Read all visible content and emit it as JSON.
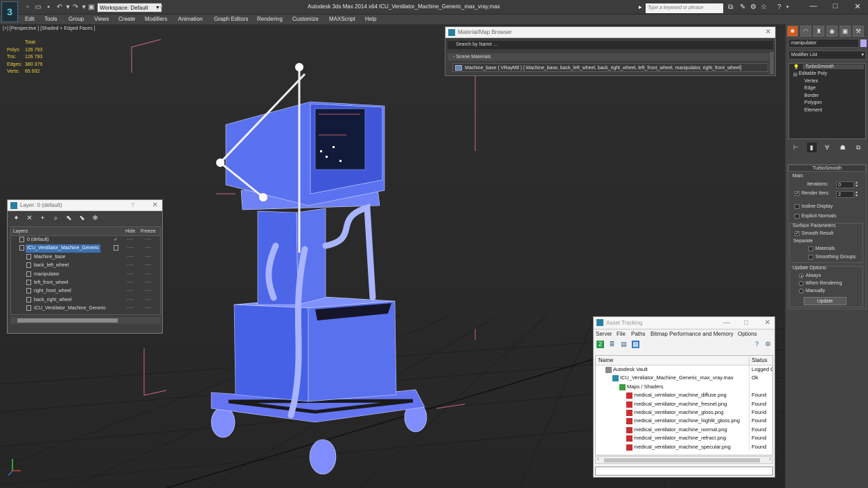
{
  "titlebar": {
    "app_logo": "3",
    "workspace_label": "Workspace: Default",
    "title": "Autodesk 3ds Max  2014 x64      ICU_Ventilator_Machine_Generic_max_vray.max",
    "search_placeholder": "Type a keyword or phrase",
    "minimize": "—",
    "maximize": "□",
    "close": "✕"
  },
  "menu": [
    "Edit",
    "Tools",
    "Group",
    "Views",
    "Create",
    "Modifiers",
    "Animation",
    "Graph Editors",
    "Rendering",
    "Customize",
    "MAXScript",
    "Help"
  ],
  "viewport": {
    "label": "[+] [Perspective ] [Shaded + Edged Faces ]",
    "stats_header": "Total",
    "stats": [
      {
        "k": "Polys:",
        "v": "126 793"
      },
      {
        "k": "Tris:",
        "v": "126 793"
      },
      {
        "k": "Edges:",
        "v": "380 379"
      },
      {
        "k": "Verts:",
        "v": "65 932"
      }
    ]
  },
  "material_browser": {
    "title": "Material/Map Browser",
    "search": "Search by Name ...",
    "section": "- Scene Materials",
    "item": "Machine_base  ( VRayMtl )  [ Machine_base, back_left_wheel, back_right_wheel, left_front_wheel, manipulator, right_front_wheel]"
  },
  "layer": {
    "title": "Layer: 0 (default)",
    "help": "?",
    "close": "✕",
    "col_layers": "Layers",
    "col_hide": "Hide",
    "col_freeze": "Freeze",
    "dash": "----",
    "rows": [
      {
        "name": "0 (default)",
        "indent": 0,
        "check": "✓"
      },
      {
        "name": "ICU_Ventilator_Machine_Generic",
        "indent": 0,
        "selected": true
      },
      {
        "name": "Machine_base",
        "indent": 1
      },
      {
        "name": "back_left_wheel",
        "indent": 1
      },
      {
        "name": "manipulator",
        "indent": 1
      },
      {
        "name": "left_front_wheel",
        "indent": 1
      },
      {
        "name": "right_front_wheel",
        "indent": 1
      },
      {
        "name": "back_right_wheel",
        "indent": 1
      },
      {
        "name": "ICU_Ventilator_Machine_Generic",
        "indent": 1
      }
    ]
  },
  "asset_tracking": {
    "title": "Asset Tracking",
    "menu": [
      "Server",
      "File",
      "Paths",
      "Bitmap Performance and Memory",
      "Options"
    ],
    "col_name": "Name",
    "col_status": "Status",
    "rows": [
      {
        "name": "Autodesk Vault",
        "status": "Logged O",
        "indent": 0,
        "icon": "vault"
      },
      {
        "name": "ICU_Ventilator_Machine_Generic_max_vray.max",
        "status": "Ok",
        "indent": 1,
        "icon": "max"
      },
      {
        "name": "Maps / Shaders",
        "status": "",
        "indent": 2,
        "icon": "maps"
      },
      {
        "name": "medical_ventilator_machine_diffuse.png",
        "status": "Found",
        "indent": 3,
        "icon": "png"
      },
      {
        "name": "medical_ventilator_machine_fresnel.png",
        "status": "Found",
        "indent": 3,
        "icon": "png"
      },
      {
        "name": "medical_ventilator_machine_gloss.png",
        "status": "Found",
        "indent": 3,
        "icon": "png"
      },
      {
        "name": "medical_ventilator_machine_highlit_gloss.png",
        "status": "Found",
        "indent": 3,
        "icon": "png"
      },
      {
        "name": "medical_ventilator_machine_normal.png",
        "status": "Found",
        "indent": 3,
        "icon": "png"
      },
      {
        "name": "medical_ventilator_machine_refract.png",
        "status": "Found",
        "indent": 3,
        "icon": "png"
      },
      {
        "name": "medical_ventilator_machine_specular.png",
        "status": "Found",
        "indent": 3,
        "icon": "png"
      }
    ]
  },
  "command_panel": {
    "object_name": "manipulator",
    "object_color": "#b7a6f0",
    "modifier_list": "Modifier List",
    "stack": {
      "turbosmooth": "TurboSmooth",
      "editable_poly": "Editable Poly",
      "subobjects": [
        "Vertex",
        "Edge",
        "Border",
        "Polygon",
        "Element"
      ]
    },
    "turbosmooth": {
      "header": "TurboSmooth",
      "main": "Main",
      "iterations_label": "Iterations:",
      "iterations": "0",
      "render_iters_label": "Render Iters:",
      "render_iters": "2",
      "isoline": "Isoline Display",
      "explicit": "Explicit Normals",
      "surface_params": "Surface Parameters",
      "smooth_result": "Smooth Result",
      "separate": "Separate",
      "materials": "Materials",
      "smoothing_groups": "Smoothing Groups",
      "update_options": "Update Options",
      "always": "Always",
      "when_rendering": "When Rendering",
      "manually": "Manually",
      "update_button": "Update"
    }
  }
}
